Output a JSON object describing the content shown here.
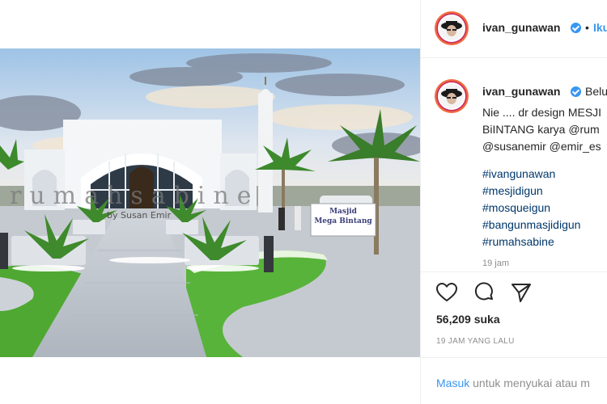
{
  "post": {
    "username": "ivan_gunawan",
    "follow_label": "Iku",
    "dot": "•",
    "caption_first": "Belu",
    "caption_lines": [
      "Nie .... dr design MESJI",
      "BiINTANG karya @rum",
      "@susanemir @emir_es"
    ],
    "hashtags": [
      "#ivangunawan",
      "#mesjidigun",
      "#mosqueigun",
      "#bangunmasjidigun",
      "#rumahsabine"
    ],
    "comment_time": "19 jam",
    "likes": "56,209 suka",
    "time_ago": "19 JAM YANG LALU",
    "login_link": "Masuk",
    "login_text": " untuk menyukai atau m"
  },
  "photo": {
    "watermark": "rumahsabine",
    "watermark_by": "by Susan Emir",
    "sign_line1": "Masjid",
    "sign_line2": "Mega Bintang"
  },
  "icons": {
    "like": "heart-icon",
    "comment": "comment-icon",
    "share": "send-icon",
    "verified": "verified-badge-icon"
  },
  "colors": {
    "link": "#3897f0",
    "mention": "#00376b",
    "muted": "#8e8e8e",
    "verified": "#3897f0"
  }
}
